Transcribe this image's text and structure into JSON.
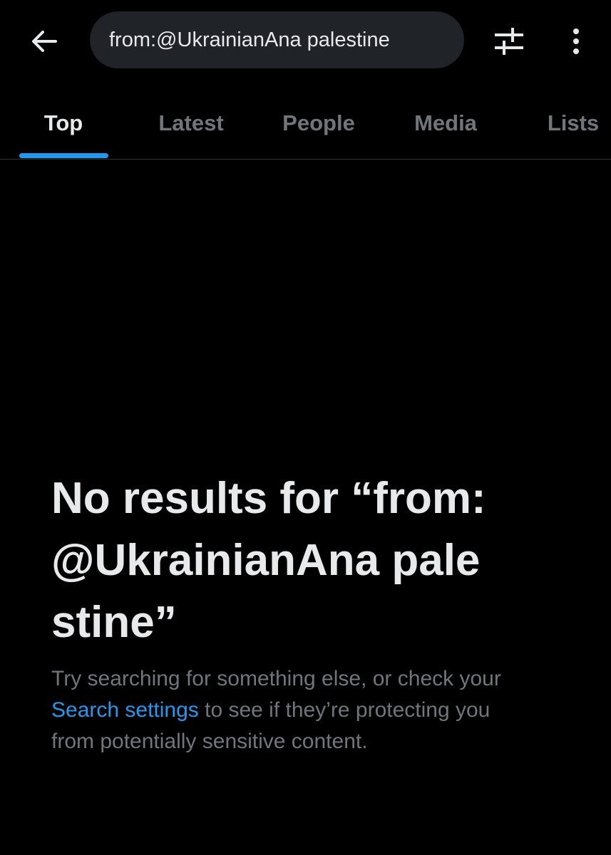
{
  "header": {
    "search_query": "from:@UkrainianAna palestine",
    "icons": {
      "back": "arrow-left-icon",
      "filter": "sliders-icon",
      "more": "more-vertical-icon"
    }
  },
  "tabs": [
    {
      "label": "Top",
      "active": true
    },
    {
      "label": "Latest",
      "active": false
    },
    {
      "label": "People",
      "active": false
    },
    {
      "label": "Media",
      "active": false
    },
    {
      "label": "Lists",
      "active": false
    }
  ],
  "empty_state": {
    "title": "No results for “from:@UkrainianAna palestine”",
    "body_prefix": "Try searching for something else, or check your ",
    "body_link": "Search settings",
    "body_suffix": " to see if they’re protecting you from potentially sensitive content."
  },
  "colors": {
    "background": "#000000",
    "text_primary": "#e7e9ea",
    "text_secondary": "#71767b",
    "accent": "#1d9bf0",
    "pill_bg": "#202327",
    "divider": "#2f3336"
  }
}
